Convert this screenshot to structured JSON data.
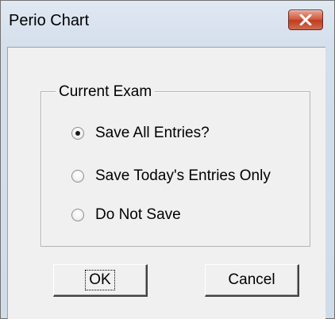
{
  "window": {
    "title": "Perio Chart",
    "close_icon": "close-icon"
  },
  "group": {
    "legend": "Current Exam",
    "options": [
      {
        "label": "Save All Entries?",
        "checked": true
      },
      {
        "label": "Save Today's Entries Only",
        "checked": false
      },
      {
        "label": "Do Not Save",
        "checked": false
      }
    ]
  },
  "buttons": {
    "ok_label": "OK",
    "cancel_label": "Cancel"
  },
  "colors": {
    "close_button": "#c8452a",
    "client_background": "#f0f0f0"
  }
}
